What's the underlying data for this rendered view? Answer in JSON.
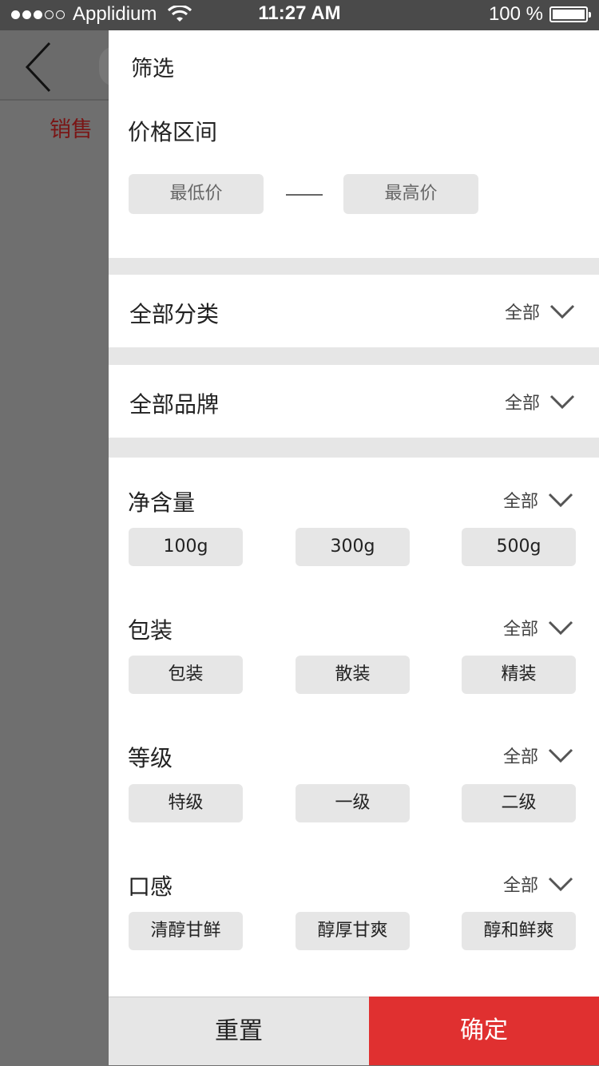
{
  "status_bar": {
    "carrier": "Applidium",
    "time": "11:27 AM",
    "battery": "100 %"
  },
  "background": {
    "tab_label": "销售"
  },
  "panel": {
    "title": "筛选",
    "price": {
      "label": "价格区间",
      "min_placeholder": "最低价",
      "max_placeholder": "最高价"
    },
    "category": {
      "label": "全部分类",
      "value": "全部"
    },
    "brand": {
      "label": "全部品牌",
      "value": "全部"
    },
    "groups": [
      {
        "label": "净含量",
        "value": "全部",
        "options": [
          "100g",
          "300g",
          "500g"
        ]
      },
      {
        "label": "包装",
        "value": "全部",
        "options": [
          "包装",
          "散装",
          "精装"
        ]
      },
      {
        "label": "等级",
        "value": "全部",
        "options": [
          "特级",
          "一级",
          "二级"
        ]
      },
      {
        "label": "口感",
        "value": "全部",
        "options": [
          "清醇甘鲜",
          "醇厚甘爽",
          "醇和鲜爽"
        ]
      }
    ],
    "reset_label": "重置",
    "confirm_label": "确定"
  },
  "colors": {
    "accent": "#e03030",
    "chip_bg": "#e6e6e6",
    "overlay": "#6f6f6f"
  },
  "icons": {
    "back": "chevron-left-icon",
    "dropdown": "chevron-down-icon",
    "wifi": "wifi-icon",
    "battery": "battery-icon"
  }
}
